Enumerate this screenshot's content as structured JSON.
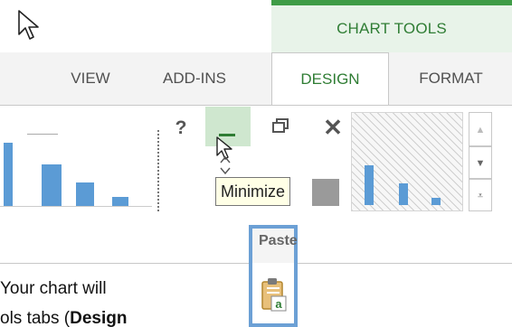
{
  "contextual_group": {
    "label": "CHART TOOLS",
    "accent_color": "#3f9c47",
    "background_color": "#e8f3e9"
  },
  "tabs": [
    {
      "label": "VIEW"
    },
    {
      "label": "ADD-INS"
    },
    {
      "label": "DESIGN",
      "selected": true
    },
    {
      "label": "FORMAT"
    }
  ],
  "window_controls": {
    "help_label": "?",
    "minimize_symbol": "–",
    "close_symbol": "✕",
    "restore_icon": "restore-icon"
  },
  "tooltip": {
    "text": "Minimize"
  },
  "gallery": {
    "up_symbol": "▲",
    "down_symbol": "▼",
    "more_symbol": "⩡"
  },
  "clipboard_group": {
    "label": "Paste",
    "icon": "paste-icon",
    "highlight_color": "#6ca0d5"
  },
  "body_text": {
    "line1": "Your chart will",
    "line2_prefix": "ols tabs (",
    "line2_bold": "Design"
  }
}
